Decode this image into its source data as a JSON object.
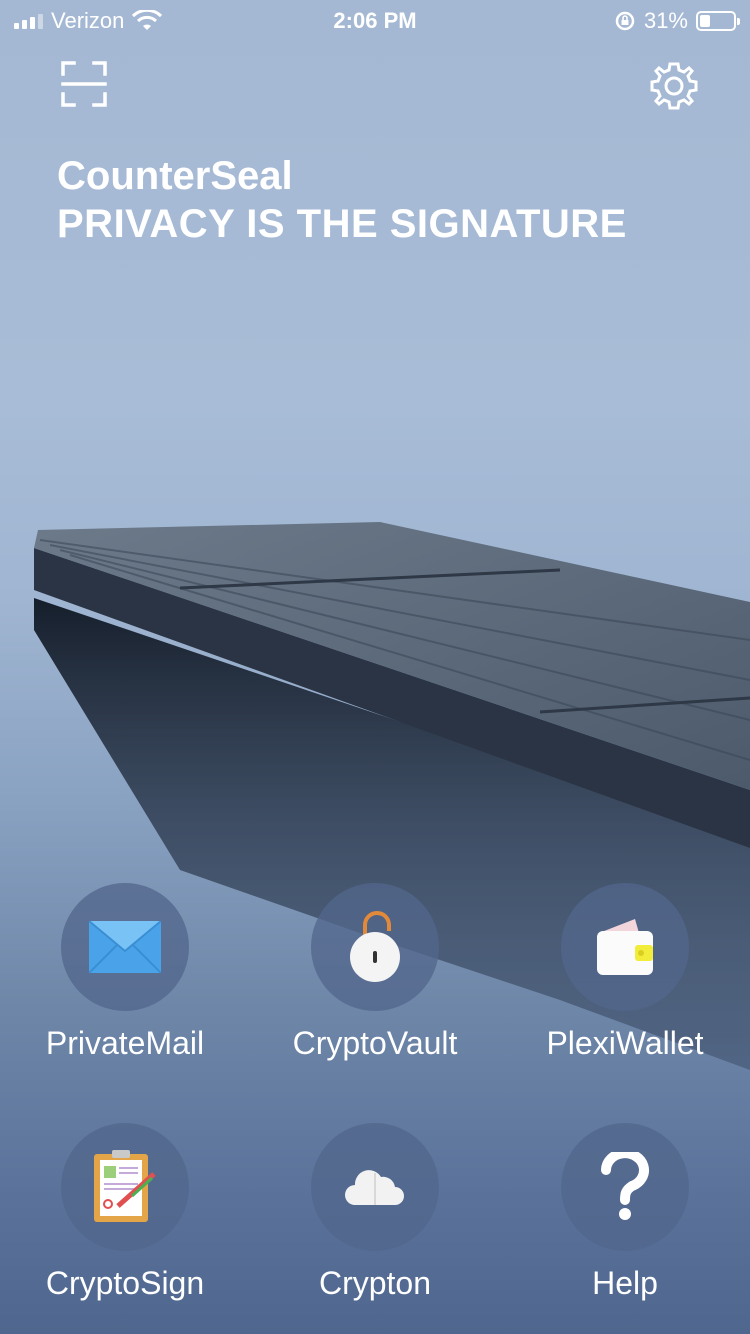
{
  "status_bar": {
    "carrier": "Verizon",
    "time": "2:06 PM",
    "battery_percent": "31%",
    "battery_level": 0.31,
    "icons": [
      "signal-icon",
      "wifi-icon",
      "rotation-lock-icon",
      "battery-icon"
    ]
  },
  "header": {
    "app_name": "CounterSeal",
    "tagline": "PRIVACY IS THE SIGNATURE",
    "icons": [
      "scan-icon",
      "gear-icon"
    ]
  },
  "apps": [
    {
      "label": "PrivateMail",
      "icon": "envelope-icon"
    },
    {
      "label": "CryptoVault",
      "icon": "padlock-icon"
    },
    {
      "label": "PlexiWallet",
      "icon": "wallet-icon"
    },
    {
      "label": "CryptoSign",
      "icon": "clipboard-sign-icon"
    },
    {
      "label": "Crypton",
      "icon": "cloud-icon"
    },
    {
      "label": "Help",
      "icon": "question-mark-icon"
    }
  ],
  "colors": {
    "app_circle": "#52668c",
    "envelope": "#4aa3e8",
    "lock_shackle": "#e38a3a",
    "wallet_accent": "#f2ec3a"
  }
}
